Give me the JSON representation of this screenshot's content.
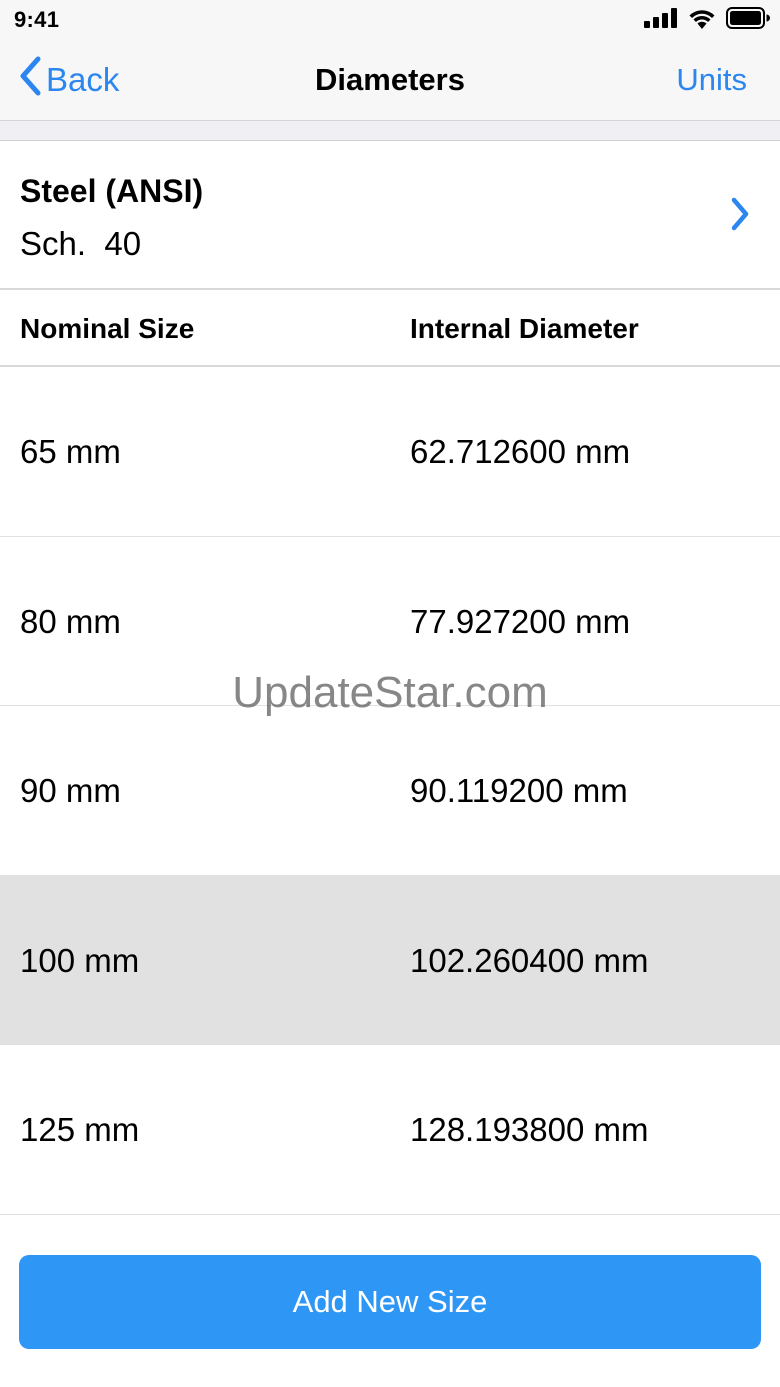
{
  "status_bar": {
    "time": "9:41",
    "signal_icon": "cellular-signal-icon",
    "wifi_icon": "wifi-icon",
    "battery_icon": "battery-icon"
  },
  "nav": {
    "back_label": "Back",
    "back_icon": "chevron-left-icon",
    "title": "Diameters",
    "units_label": "Units"
  },
  "material": {
    "name": "Steel (ANSI)",
    "schedule": "Sch.  40",
    "chevron_icon": "chevron-right-icon"
  },
  "table": {
    "headers": {
      "nominal": "Nominal Size",
      "internal": "Internal Diameter"
    },
    "rows": [
      {
        "nominal": "65 mm",
        "internal": "62.712600 mm",
        "selected": false
      },
      {
        "nominal": "80 mm",
        "internal": "77.927200 mm",
        "selected": false
      },
      {
        "nominal": "90 mm",
        "internal": "90.119200 mm",
        "selected": false
      },
      {
        "nominal": "100 mm",
        "internal": "102.260400 mm",
        "selected": true
      },
      {
        "nominal": "125 mm",
        "internal": "128.193800 mm",
        "selected": false
      }
    ]
  },
  "watermark": "UpdateStar.com",
  "add_button_label": "Add New Size",
  "colors": {
    "accent": "#2c86f0",
    "button": "#2e97f5",
    "selected_row": "#e1e1e1",
    "bar_background": "#f7f7f7"
  }
}
